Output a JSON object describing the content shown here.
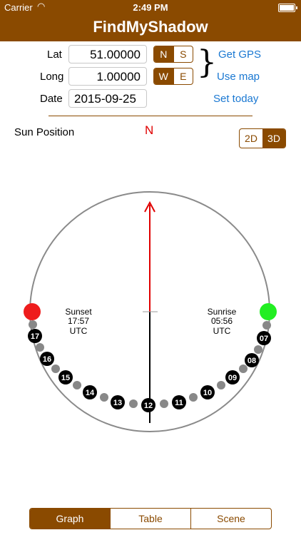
{
  "status": {
    "carrier": "Carrier",
    "time": "2:49 PM"
  },
  "nav": {
    "title": "FindMyShadow"
  },
  "form": {
    "lat_label": "Lat",
    "lat_value": "51.00000",
    "ns": [
      "N",
      "S"
    ],
    "long_label": "Long",
    "long_value": "1.00000",
    "we": [
      "W",
      "E"
    ],
    "date_label": "Date",
    "date_value": "2015-09-25"
  },
  "links": {
    "get_gps": "Get GPS",
    "use_map": "Use map",
    "set_today": "Set today"
  },
  "view": {
    "sun_position_label": "Sun Position",
    "north": "N",
    "modes": [
      "2D",
      "3D"
    ]
  },
  "diagram": {
    "sunset": [
      "Sunset",
      "17:57",
      "UTC"
    ],
    "sunrise": [
      "Sunrise",
      "05:56",
      "UTC"
    ],
    "hours": [
      "17",
      "16",
      "15",
      "14",
      "13",
      "12",
      "11",
      "10",
      "09",
      "08",
      "07"
    ],
    "colors": {
      "sunset": "#ee1c1c",
      "sunrise": "#22ee22",
      "arrow": "#e00000",
      "hour": "#000000",
      "dot": "#888888"
    }
  },
  "tabs": [
    "Graph",
    "Table",
    "Scene"
  ]
}
